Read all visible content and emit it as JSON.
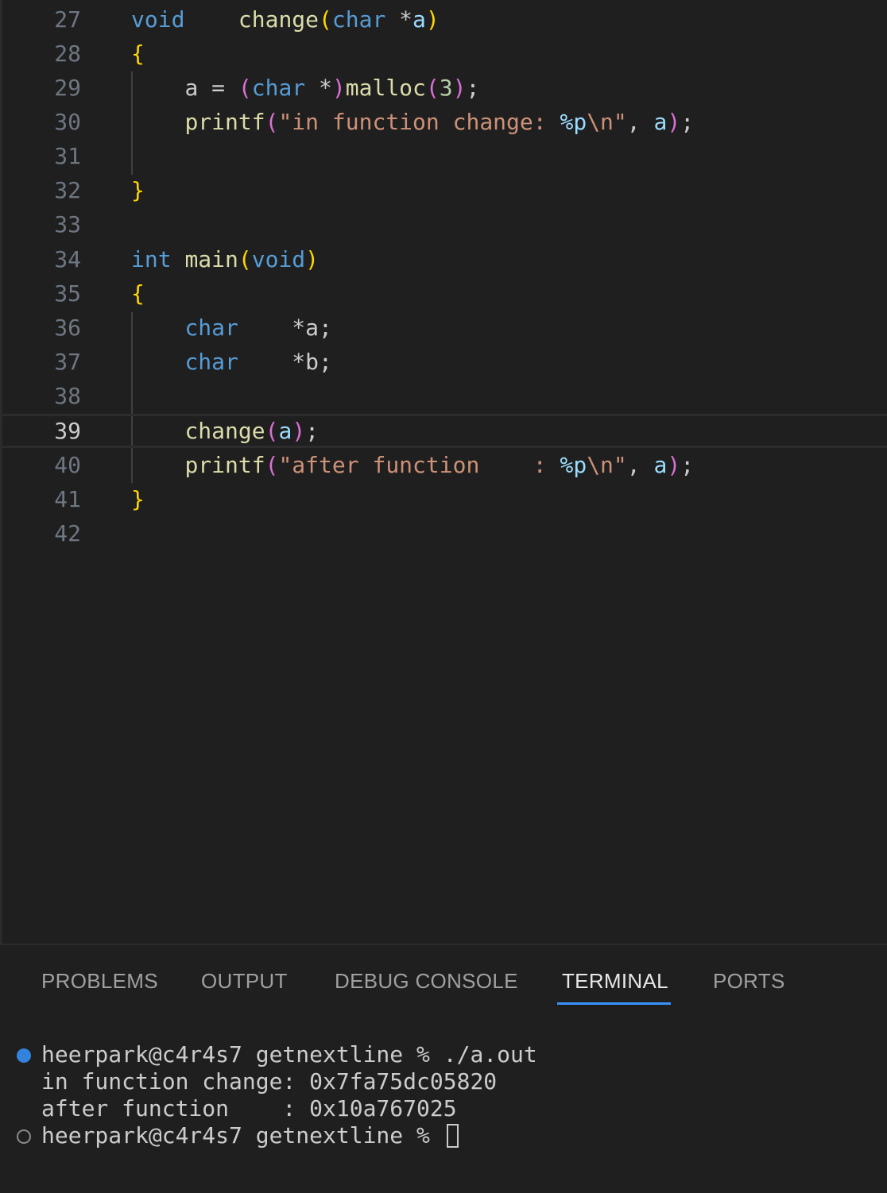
{
  "editor": {
    "line_numbers": [
      "27",
      "28",
      "29",
      "30",
      "31",
      "32",
      "33",
      "34",
      "35",
      "36",
      "37",
      "38",
      "39",
      "40",
      "41",
      "42"
    ],
    "current_line": "39",
    "tokens": {
      "l27_void": "void",
      "l27_sp": "    ",
      "l27_change": "change",
      "l27_lp": "(",
      "l27_char": "char",
      "l27_star": " *",
      "l27_a": "a",
      "l27_rp": ")",
      "l28_brace": "{",
      "l29_indent": "    ",
      "l29_a_eq": "a = ",
      "l29_lp": "(",
      "l29_char": "char",
      "l29_star": " *",
      "l29_rp": ")",
      "l29_malloc": "malloc",
      "l29_lp2": "(",
      "l29_3": "3",
      "l29_rp2": ")",
      "l29_semi": ";",
      "l30_indent": "    ",
      "l30_printf": "printf",
      "l30_lp": "(",
      "l30_str1": "\"in function change: ",
      "l30_fmt": "%p",
      "l30_esc": "\\n",
      "l30_str2": "\"",
      "l30_comma": ", ",
      "l30_a": "a",
      "l30_rp": ")",
      "l30_semi": ";",
      "l32_brace": "}",
      "l34_int": "int",
      "l34_sp": " ",
      "l34_main": "main",
      "l34_lp": "(",
      "l34_void": "void",
      "l34_rp": ")",
      "l35_brace": "{",
      "l36_indent": "    ",
      "l36_char": "char",
      "l36_var": "    *a;",
      "l37_indent": "    ",
      "l37_char": "char",
      "l37_var": "    *b;",
      "l39_indent": "    ",
      "l39_change": "change",
      "l39_lp": "(",
      "l39_a": "a",
      "l39_rp": ")",
      "l39_semi": ";",
      "l40_indent": "    ",
      "l40_printf": "printf",
      "l40_lp": "(",
      "l40_str1": "\"after function    : ",
      "l40_fmt": "%p",
      "l40_esc": "\\n",
      "l40_str2": "\"",
      "l40_comma": ", ",
      "l40_a": "a",
      "l40_rp": ")",
      "l40_semi": ";",
      "l41_brace": "}"
    }
  },
  "panel": {
    "tabs": [
      {
        "label": "PROBLEMS",
        "active": false
      },
      {
        "label": "OUTPUT",
        "active": false
      },
      {
        "label": "DEBUG CONSOLE",
        "active": false
      },
      {
        "label": "TERMINAL",
        "active": true
      },
      {
        "label": "PORTS",
        "active": false
      }
    ]
  },
  "terminal": {
    "lines": [
      "heerpark@c4r4s7 getnextline % ./a.out",
      "in function change: 0x7fa75dc05820",
      "after function    : 0x10a767025",
      "heerpark@c4r4s7 getnextline % "
    ],
    "dot_first": "success",
    "dot_last": "idle"
  },
  "colors": {
    "background": "#1f1f1f",
    "keyword": "#569cd6",
    "function": "#dcdcaa",
    "string": "#ce9178",
    "bracket_level1": "#ffd700",
    "bracket_level2": "#da70d6",
    "tab_active_underline": "#3794ff"
  }
}
